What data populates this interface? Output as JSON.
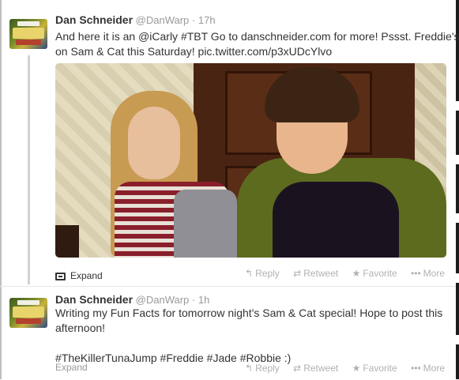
{
  "tweets": [
    {
      "name": "Dan Schneider",
      "handle": "@DanWarp",
      "separator": "·",
      "time": "17h",
      "text_lines": [
        "And here it is an @iCarly #TBT Go to danschneider.com for more! Pssst. Freddie's",
        "on Sam & Cat this Saturday! pic.twitter.com/p3xUDcYlvo"
      ],
      "expand_label": "Expand",
      "actions": {
        "reply": "Reply",
        "retweet": "Retweet",
        "favorite": "Favorite",
        "more": "More"
      }
    },
    {
      "name": "Dan Schneider",
      "handle": "@DanWarp",
      "separator": "·",
      "time": "1h",
      "text_lines": [
        "Writing my Fun Facts for tomorrow night's Sam & Cat special!  Hope to post this",
        "afternoon!",
        "",
        "#TheKillerTunaJump  #Freddie #Jade #Robbie :)"
      ],
      "expand_label": "Expand",
      "actions": {
        "reply": "Reply",
        "retweet": "Retweet",
        "favorite": "Favorite",
        "more": "More"
      }
    }
  ],
  "icons": {
    "reply": "reply-arrow-icon",
    "retweet": "retweet-icon",
    "favorite": "star-icon",
    "more": "ellipsis-icon",
    "media": "media-photo-icon"
  },
  "colors": {
    "name": "#333333",
    "meta": "#999999",
    "action": "#b1b1b1",
    "background": "#ffffff"
  }
}
